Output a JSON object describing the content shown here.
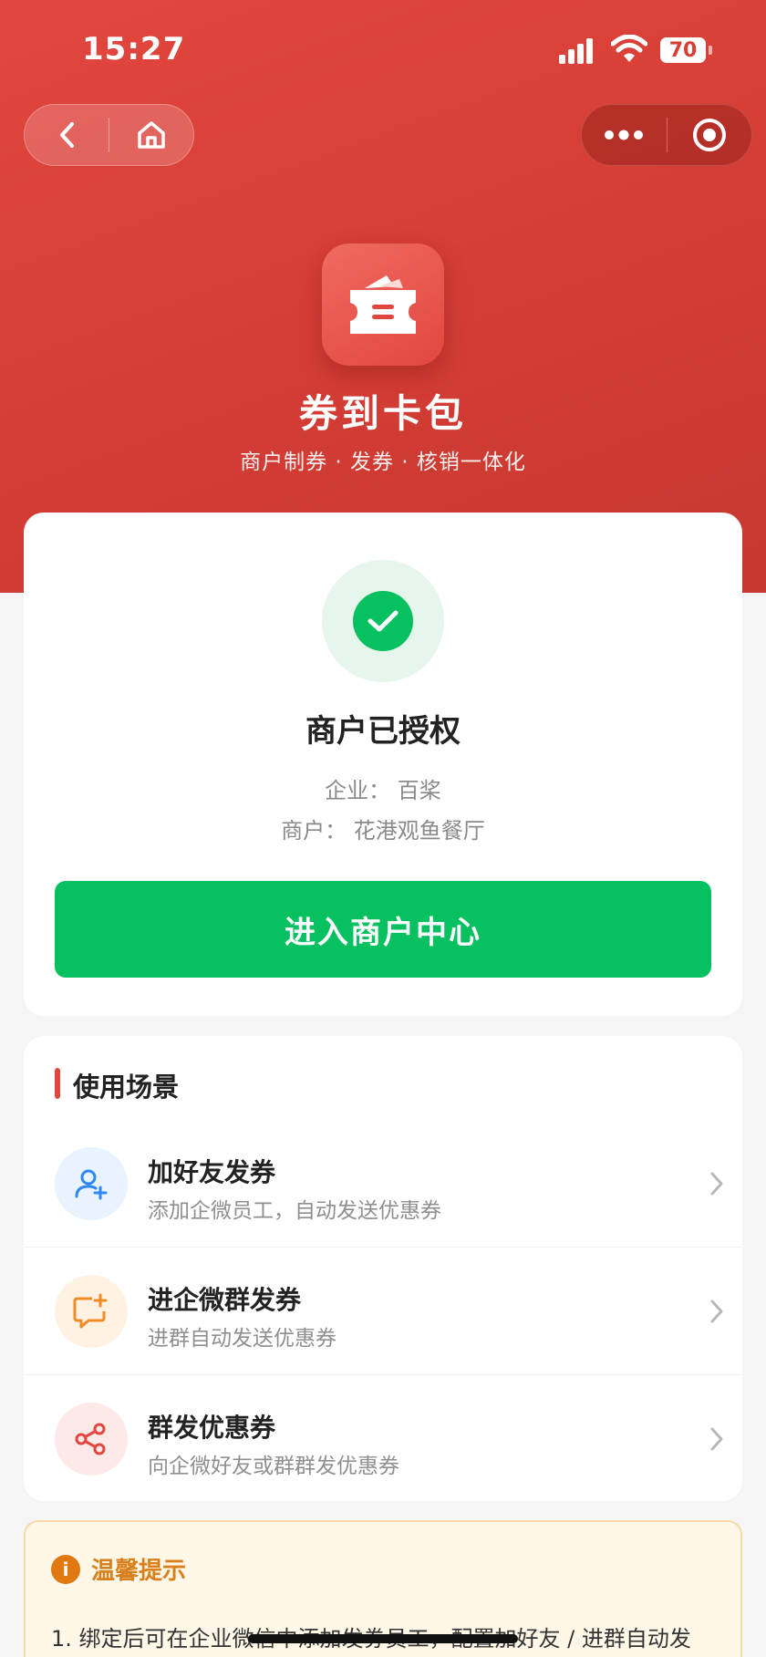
{
  "status_bar": {
    "time": "15:27",
    "battery": "70"
  },
  "nav": {
    "back_icon": "chevron-left-icon",
    "home_icon": "home-icon",
    "more_icon": "more-dots-icon",
    "close_icon": "target-circle-icon"
  },
  "header": {
    "app_name": "券到卡包",
    "subtitle": "商户制券 · 发券 · 核销一体化",
    "logo_icon": "wallet-ticket-icon"
  },
  "auth": {
    "title": "商户已授权",
    "enterprise": "企业：  百桨",
    "merchant": "商户：  花港观鱼餐厅",
    "enter_button": "进入商户中心",
    "status_icon": "check-icon"
  },
  "scenes": {
    "section_title": "使用场景",
    "items": [
      {
        "title": "加好友发券",
        "desc": "添加企微员工，自动发送优惠券",
        "icon": "add-user-icon"
      },
      {
        "title": "进企微群发券",
        "desc": "进群自动发送优惠券",
        "icon": "group-chat-add-icon"
      },
      {
        "title": "群发优惠券",
        "desc": "向企微好友或群群发优惠券",
        "icon": "share-icon"
      }
    ]
  },
  "tips": {
    "title": "温馨提示",
    "line1": "1. 绑定后可在企业微信中添加发券员工，配置加好友 / 进群自动发"
  },
  "colors": {
    "brand_red": "#e2473f",
    "green": "#07c160",
    "tip_orange": "#d9801c"
  }
}
